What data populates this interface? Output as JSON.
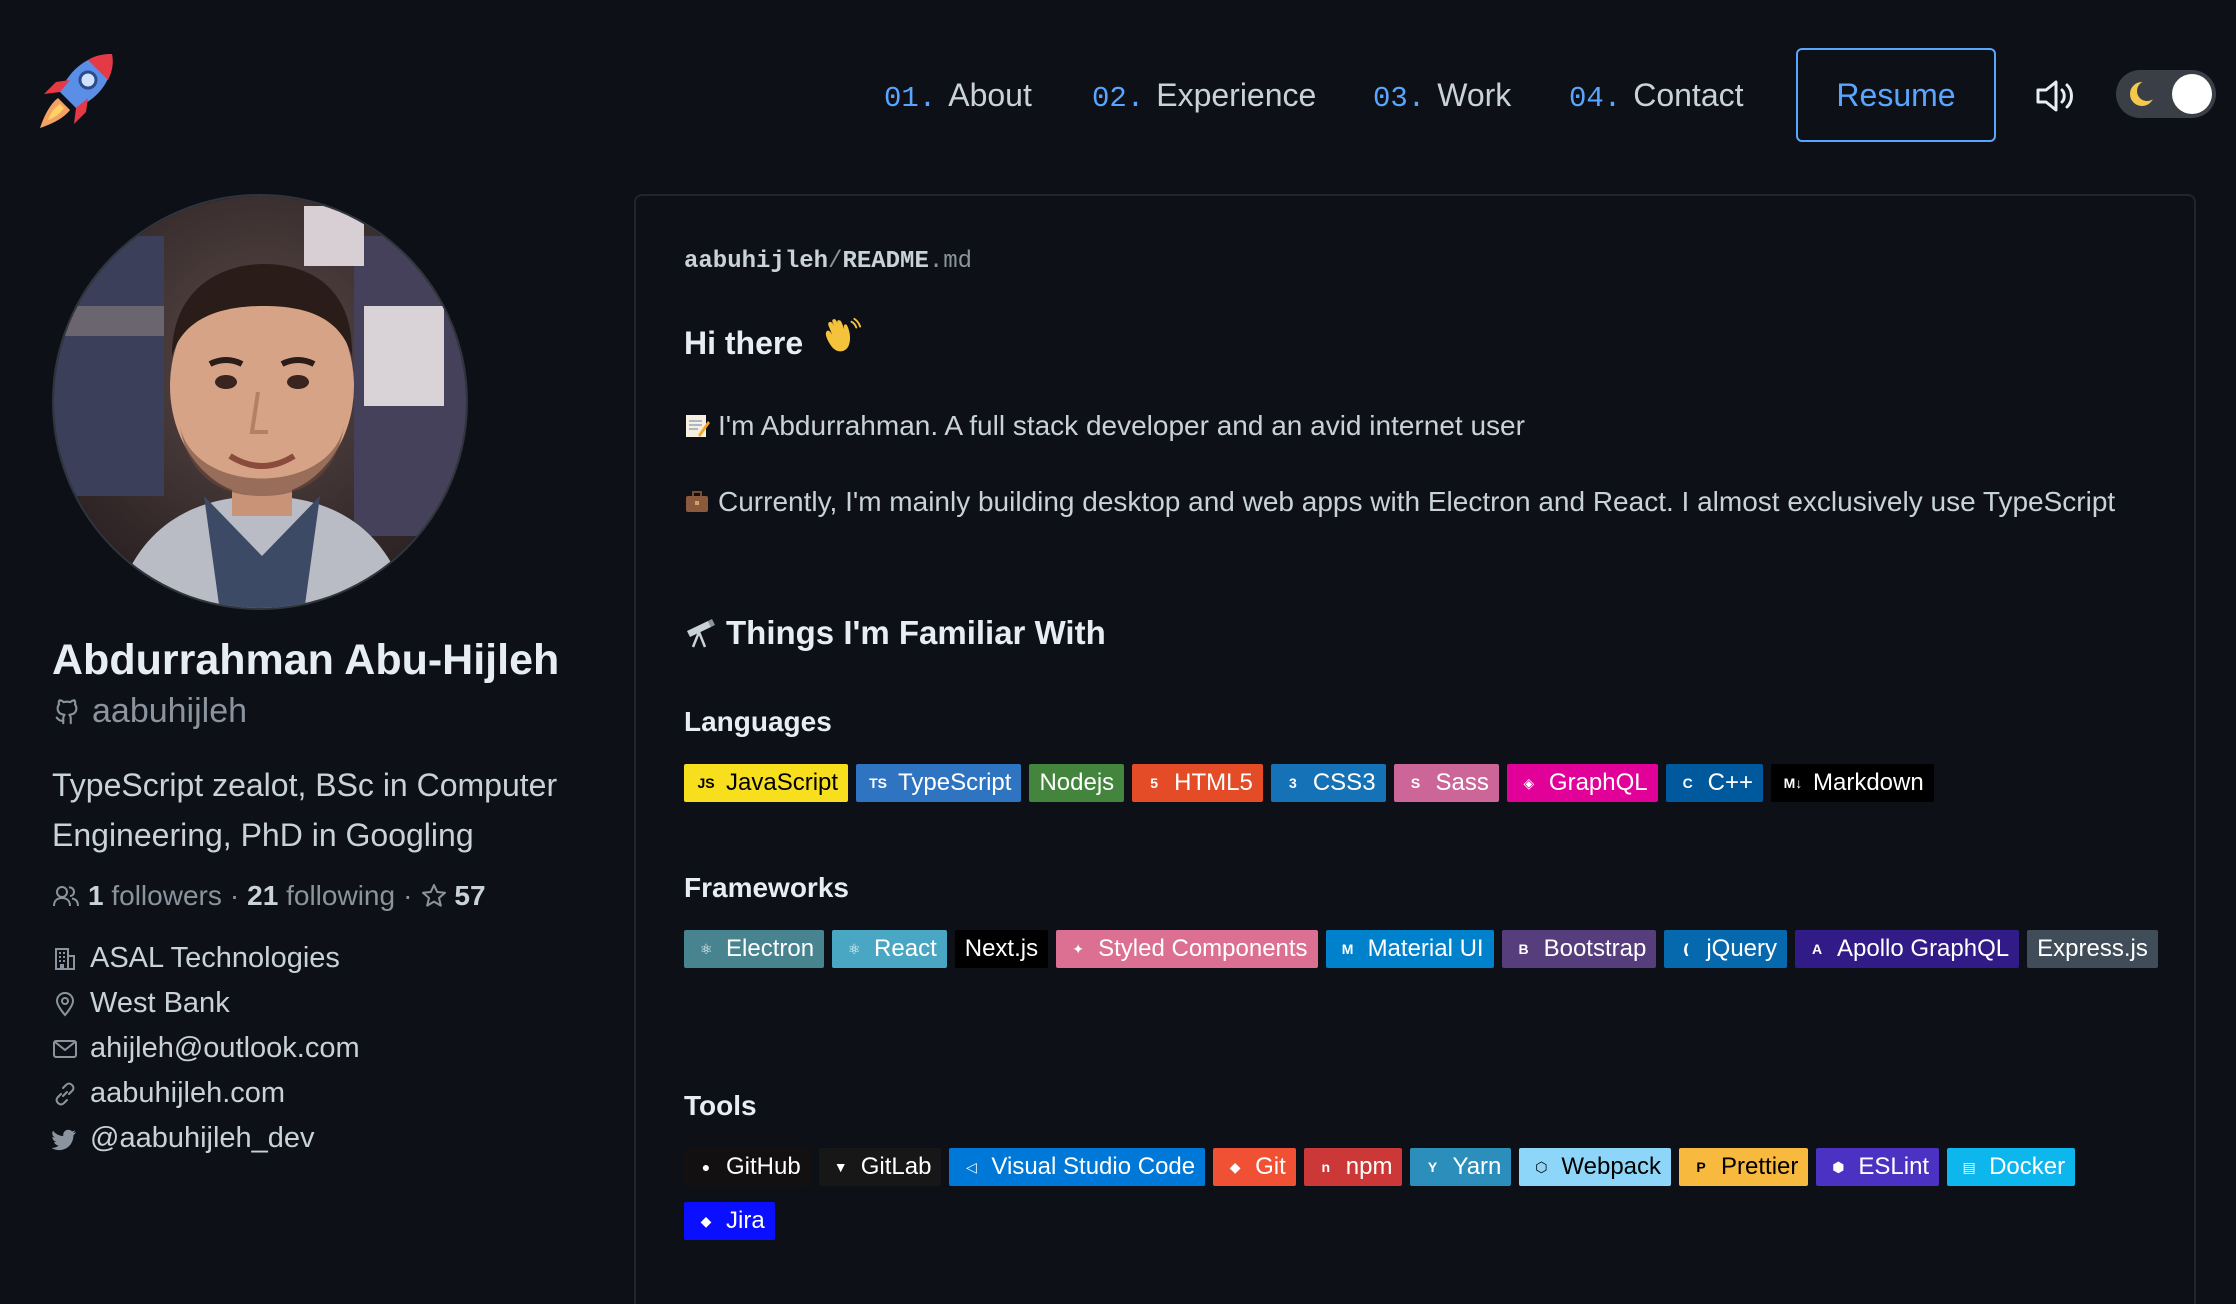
{
  "header": {
    "logo_icon": "rocket-icon",
    "nav": [
      {
        "num": "01.",
        "label": "About"
      },
      {
        "num": "02.",
        "label": "Experience"
      },
      {
        "num": "03.",
        "label": "Work"
      },
      {
        "num": "04.",
        "label": "Contact"
      }
    ],
    "resume_label": "Resume",
    "sound_icon": "speaker-icon",
    "theme_icon": "moon-icon",
    "accent": "#58a6ff"
  },
  "profile": {
    "name": "Abdurrahman Abu-Hijleh",
    "login": "aabuhijleh",
    "bio": "TypeScript zealot, BSc in Computer Engineering, PhD in Googling",
    "followers_count": "1",
    "followers_label": "followers",
    "following_count": "21",
    "following_label": "following",
    "stars": "57",
    "company": "ASAL Technologies",
    "location": "West Bank",
    "email": "ahijleh@outlook.com",
    "website": "aabuhijleh.com",
    "twitter": "@aabuhijleh_dev"
  },
  "readme": {
    "path_user": "aabuhijleh",
    "path_sep": "/",
    "path_file": "README",
    "path_ext": ".md",
    "greeting": "Hi there",
    "intro": "I'm Abdurrahman. A full stack developer and an avid internet user",
    "current": "Currently, I'm mainly building desktop and web apps with Electron and React. I almost exclusively use TypeScript",
    "familiar_heading": "Things I'm Familiar With",
    "languages_heading": "Languages",
    "frameworks_heading": "Frameworks",
    "tools_heading": "Tools",
    "languages": [
      {
        "label": "JavaScript",
        "icon": "js-icon",
        "bg": "#f7df1e",
        "fg": "#000000"
      },
      {
        "label": "TypeScript",
        "icon": "ts-icon",
        "bg": "#2f74c0",
        "fg": "#ffffff"
      },
      {
        "label": "Nodejs",
        "icon": "",
        "bg": "#43853d",
        "fg": "#ffffff"
      },
      {
        "label": "HTML5",
        "icon": "html5-icon",
        "bg": "#e34c26",
        "fg": "#ffffff"
      },
      {
        "label": "CSS3",
        "icon": "css3-icon",
        "bg": "#1572b6",
        "fg": "#ffffff"
      },
      {
        "label": "Sass",
        "icon": "sass-icon",
        "bg": "#cc6699",
        "fg": "#ffffff"
      },
      {
        "label": "GraphQL",
        "icon": "graphql-icon",
        "bg": "#e10098",
        "fg": "#ffffff"
      },
      {
        "label": "C++",
        "icon": "cpp-icon",
        "bg": "#00599c",
        "fg": "#ffffff"
      },
      {
        "label": "Markdown",
        "icon": "markdown-icon",
        "bg": "#000000",
        "fg": "#ffffff"
      }
    ],
    "frameworks": [
      {
        "label": "Electron",
        "icon": "electron-icon",
        "bg": "#47848f",
        "fg": "#ffffff"
      },
      {
        "label": "React",
        "icon": "react-icon",
        "bg": "#20232a",
        "fg": "#61dafb",
        "alt_bg": "#4aa7c4"
      },
      {
        "label": "Next.js",
        "icon": "",
        "bg": "#000000",
        "fg": "#ffffff"
      },
      {
        "label": "Styled Components",
        "icon": "styled-components-icon",
        "bg": "#db7093",
        "fg": "#ffffff"
      },
      {
        "label": "Material UI",
        "icon": "material-ui-icon",
        "bg": "#0081cb",
        "fg": "#ffffff"
      },
      {
        "label": "Bootstrap",
        "icon": "bootstrap-icon",
        "bg": "#563d7c",
        "fg": "#ffffff"
      },
      {
        "label": "jQuery",
        "icon": "jquery-icon",
        "bg": "#0769ad",
        "fg": "#ffffff"
      },
      {
        "label": "Apollo GraphQL",
        "icon": "apollo-icon",
        "bg": "#311c87",
        "fg": "#ffffff"
      },
      {
        "label": "Express.js",
        "icon": "",
        "bg": "#404d59",
        "fg": "#ffffff"
      }
    ],
    "tools": [
      {
        "label": "GitHub",
        "icon": "github-icon",
        "bg": "#121011",
        "fg": "#ffffff"
      },
      {
        "label": "GitLab",
        "icon": "gitlab-icon",
        "bg": "#181717",
        "fg": "#ffffff"
      },
      {
        "label": "Visual Studio Code",
        "icon": "vscode-icon",
        "bg": "#0078d7",
        "fg": "#ffffff"
      },
      {
        "label": "Git",
        "icon": "git-icon",
        "bg": "#f05033",
        "fg": "#ffffff"
      },
      {
        "label": "npm",
        "icon": "npm-icon",
        "bg": "#cb3837",
        "fg": "#ffffff"
      },
      {
        "label": "Yarn",
        "icon": "yarn-icon",
        "bg": "#2c8ebb",
        "fg": "#ffffff"
      },
      {
        "label": "Webpack",
        "icon": "webpack-icon",
        "bg": "#8dd6f9",
        "fg": "#000000"
      },
      {
        "label": "Prettier",
        "icon": "prettier-icon",
        "bg": "#f7b93e",
        "fg": "#000000"
      },
      {
        "label": "ESLint",
        "icon": "eslint-icon",
        "bg": "#4b32c3",
        "fg": "#ffffff"
      },
      {
        "label": "Docker",
        "icon": "docker-icon",
        "bg": "#0db7ed",
        "fg": "#ffffff"
      },
      {
        "label": "Jira",
        "icon": "jira-icon",
        "bg": "#0a0fff",
        "fg": "#ffffff"
      }
    ]
  }
}
